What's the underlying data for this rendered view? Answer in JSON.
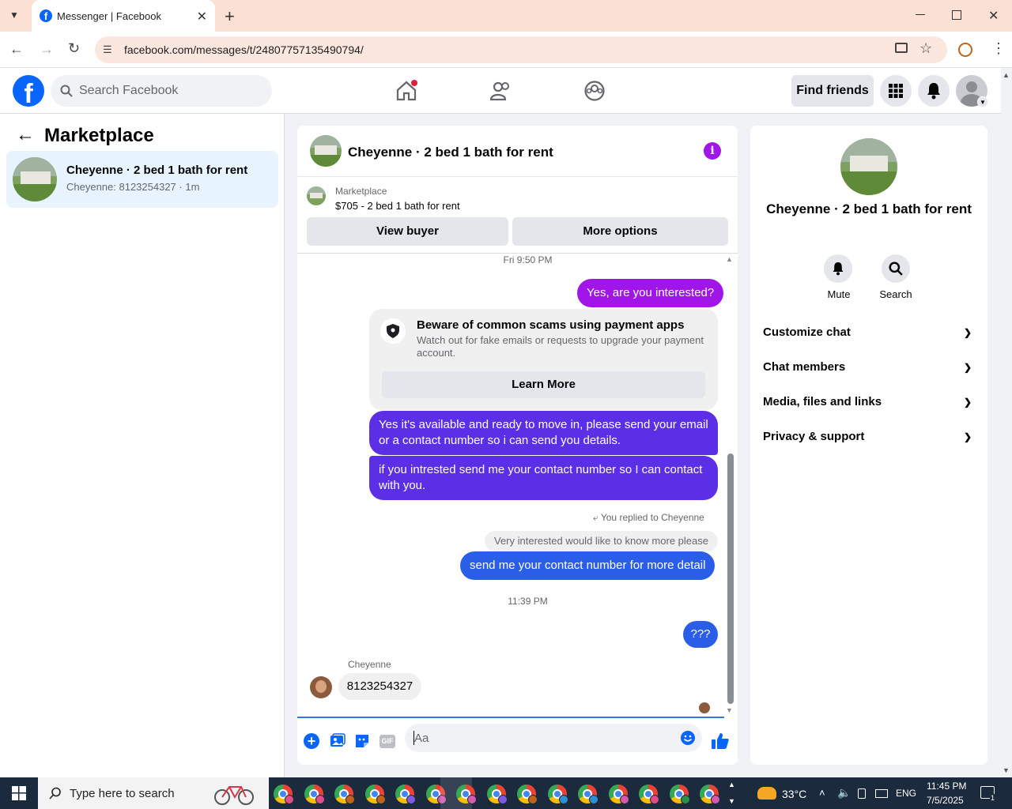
{
  "browser": {
    "tab_title": "Messenger | Facebook",
    "url": "facebook.com/messages/t/24807757135490794/"
  },
  "fb_header": {
    "search_placeholder": "Search Facebook",
    "find_friends": "Find friends"
  },
  "left_pane": {
    "title": "Marketplace",
    "conversation": {
      "name": "Cheyenne · 2 bed 1 bath for rent",
      "preview": "Cheyenne: 8123254327 · 1m"
    }
  },
  "chat": {
    "title": "Cheyenne · 2 bed 1 bath for rent",
    "marketplace_label": "Marketplace",
    "listing": "$705 - 2 bed 1 bath for rent",
    "view_buyer": "View buyer",
    "more_options": "More options",
    "timestamp_1": "Fri 9:50 PM",
    "msg_1": "Yes, are you interested?",
    "scam_title": "Beware of common scams using payment apps",
    "scam_text": "Watch out for fake emails or requests to upgrade your payment account.",
    "learn_more": "Learn More",
    "msg_2": "Yes it's available and ready to move in, please send your email or a contact number so i can send you details.",
    "msg_3": "if you intrested send me your contact number so I can contact with you.",
    "replied_label": "You replied to Cheyenne",
    "quoted": "Very interested would like to know more please",
    "msg_4": "send me your contact number for more detail",
    "timestamp_2": "11:39 PM",
    "msg_5": "???",
    "sender_name": "Cheyenne",
    "msg_6": "8123254327",
    "composer_placeholder": "Aa"
  },
  "right_pane": {
    "title": "Cheyenne · 2 bed 1 bath for rent",
    "mute": "Mute",
    "search": "Search",
    "sections": [
      "Customize chat",
      "Chat members",
      "Media, files and links",
      "Privacy & support"
    ]
  },
  "taskbar": {
    "search_text": "Type here to search",
    "temperature": "33°C",
    "language": "ENG",
    "time": "11:45 PM",
    "date": "7/5/2025",
    "notification_count": "1"
  },
  "colors": {
    "fb_blue": "#0866ff",
    "purple_bubble": "#a016e8",
    "indigo_bubble": "#5b2fe6",
    "blue_bubble": "#2a5ee8"
  }
}
